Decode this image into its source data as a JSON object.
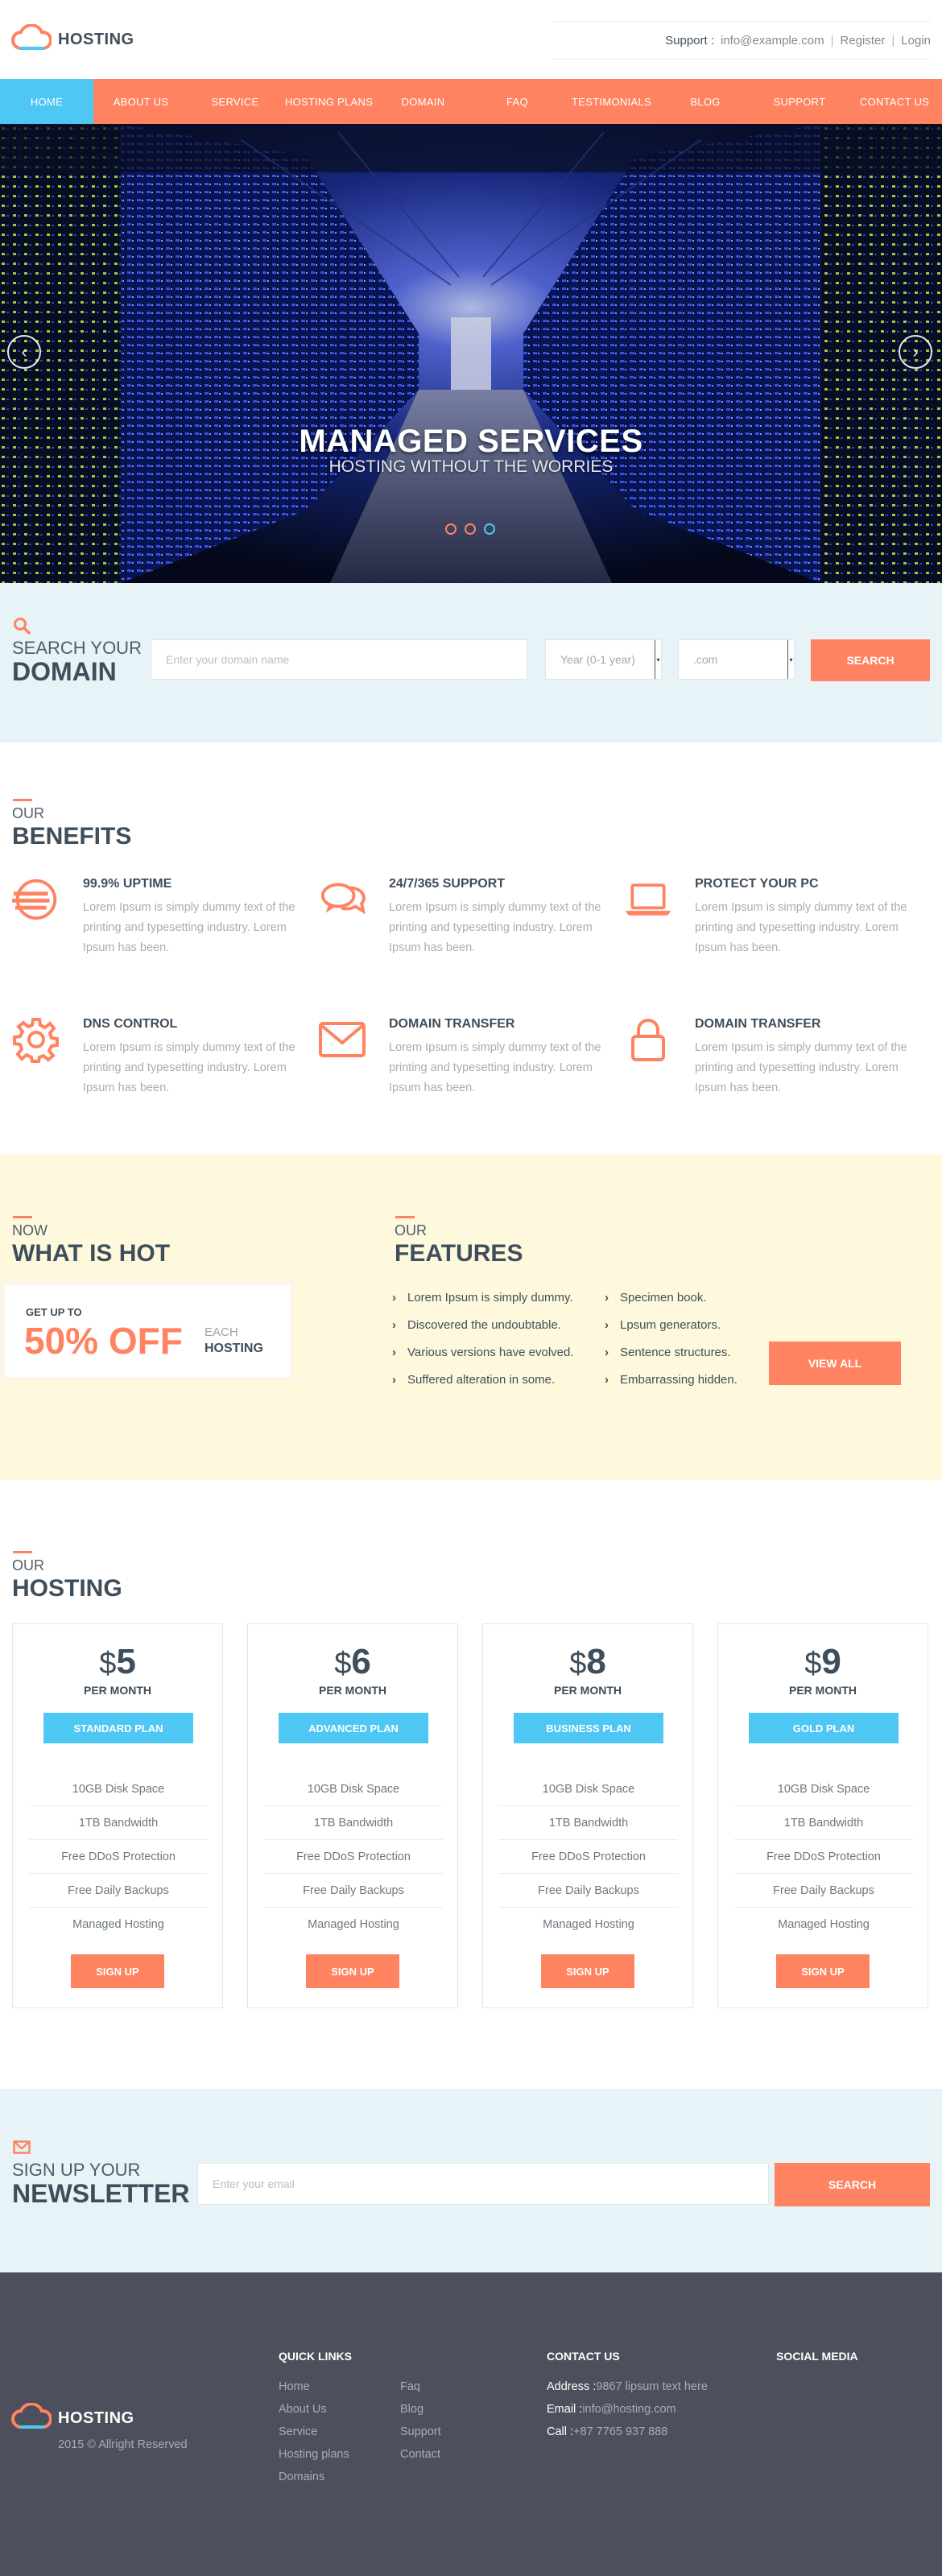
{
  "brand": {
    "name": "HOSTING",
    "accent": "#ff8361",
    "secondary": "#4ec7f4",
    "dark": "#3f4e5b"
  },
  "header": {
    "support_label": "Support :",
    "support_email": "info@example.com",
    "register": "Register",
    "login": "Login",
    "separator": "|"
  },
  "nav": {
    "items": [
      "HOME",
      "ABOUT US",
      "SERVICE",
      "HOSTING PLANS",
      "DOMAIN",
      "FAQ",
      "TESTIMONIALS",
      "BLOG",
      "SUPPORT",
      "CONTACT US"
    ],
    "active": "HOME"
  },
  "hero": {
    "title": "MANAGED SERVICES",
    "subtitle": "HOSTING WITHOUT THE WORRIES",
    "prev_icon": "chevron-left-icon",
    "next_icon": "chevron-right-icon",
    "slide_count": 3,
    "active_slide": 3
  },
  "domain_search": {
    "kicker": "SEARCH YOUR",
    "title": "DOMAIN",
    "placeholder": "Enter your domain name",
    "year_value": "Year (0-1 year)",
    "tld_value": ".com",
    "button": "SEARCH",
    "icon": "search-icon"
  },
  "benefits": {
    "kicker": "OUR",
    "title": "BENEFITS",
    "items": [
      {
        "title": "99.9% UPTIME",
        "text": "Lorem Ipsum is simply dummy text of the printing and typesetting industry. Lorem Ipsum has been.",
        "icon": "uptime-icon"
      },
      {
        "title": "24/7/365 SUPPORT",
        "text": "Lorem Ipsum is simply dummy text of the printing and typesetting industry. Lorem Ipsum has been.",
        "icon": "chat-icon"
      },
      {
        "title": "PROTECT YOUR PC",
        "text": "Lorem Ipsum is simply dummy text of the printing and typesetting industry. Lorem Ipsum has been.",
        "icon": "laptop-icon"
      },
      {
        "title": "DNS CONTROL",
        "text": "Lorem Ipsum is simply dummy text of the printing and typesetting industry. Lorem Ipsum has been.",
        "icon": "gear-icon"
      },
      {
        "title": "DOMAIN TRANSFER",
        "text": "Lorem Ipsum is simply dummy text of the printing and typesetting industry. Lorem Ipsum has been.",
        "icon": "envelope-icon"
      },
      {
        "title": "DOMAIN TRANSFER",
        "text": "Lorem Ipsum is simply dummy text of the printing and typesetting industry. Lorem Ipsum has been.",
        "icon": "lock-icon"
      }
    ]
  },
  "hot": {
    "kicker": "NOW",
    "title": "WHAT IS HOT",
    "promo_top": "GET UP TO",
    "promo_big": "50% OFF",
    "promo_each": "EACH",
    "promo_hosting": "HOSTING"
  },
  "features": {
    "kicker": "OUR",
    "title": "FEATURES",
    "col1": [
      "Lorem Ipsum is simply dummy.",
      "Discovered the undoubtable.",
      "Various versions have evolved.",
      "Suffered alteration in some."
    ],
    "col2": [
      "Specimen book.",
      "Lpsum generators.",
      "Sentence structures.",
      "Embarrassing hidden."
    ],
    "button": "VIEW ALL"
  },
  "hosting": {
    "kicker": "OUR",
    "title": "HOSTING",
    "plans": [
      {
        "currency": "$",
        "price": "5",
        "per": "PER MONTH",
        "name": "STANDARD PLAN",
        "features": [
          "10GB Disk Space",
          "1TB Bandwidth",
          "Free DDoS Protection",
          "Free Daily Backups",
          "Managed Hosting"
        ],
        "button": "SIGN UP"
      },
      {
        "currency": "$",
        "price": "6",
        "per": "PER MONTH",
        "name": "ADVANCED PLAN",
        "features": [
          "10GB Disk Space",
          "1TB Bandwidth",
          "Free DDoS Protection",
          "Free Daily Backups",
          "Managed Hosting"
        ],
        "button": "SIGN UP"
      },
      {
        "currency": "$",
        "price": "8",
        "per": "PER MONTH",
        "name": "BUSINESS PLAN",
        "features": [
          "10GB Disk Space",
          "1TB Bandwidth",
          "Free DDoS Protection",
          "Free Daily Backups",
          "Managed Hosting"
        ],
        "button": "SIGN UP"
      },
      {
        "currency": "$",
        "price": "9",
        "per": "PER MONTH",
        "name": "GOLD PLAN",
        "features": [
          "10GB Disk Space",
          "1TB Bandwidth",
          "Free DDoS Protection",
          "Free Daily Backups",
          "Managed Hosting"
        ],
        "button": "SIGN UP"
      }
    ]
  },
  "newsletter": {
    "kicker": "SIGN UP YOUR",
    "title": "NEWSLETTER",
    "placeholder": "Enter your email",
    "button": "SEARCH",
    "icon": "envelope-icon"
  },
  "footer": {
    "brand": "HOSTING",
    "copyright": "2015 © Allright Reserved",
    "quick_links_title": "QUICK LINKS",
    "links_col1": [
      "Home",
      "About Us",
      "Service",
      "Hosting plans",
      "Domains"
    ],
    "links_col2": [
      "Faq",
      "Blog",
      "Support",
      "Contact"
    ],
    "contact_title": "CONTACT US",
    "address_label": "Address :",
    "address": "9867 lipsum text here",
    "email_label": "Email :",
    "email": "info@hosting.com",
    "call_label": "Call :",
    "call": "+87 7765 937 888",
    "social_title": "SOCIAL MEDIA"
  }
}
